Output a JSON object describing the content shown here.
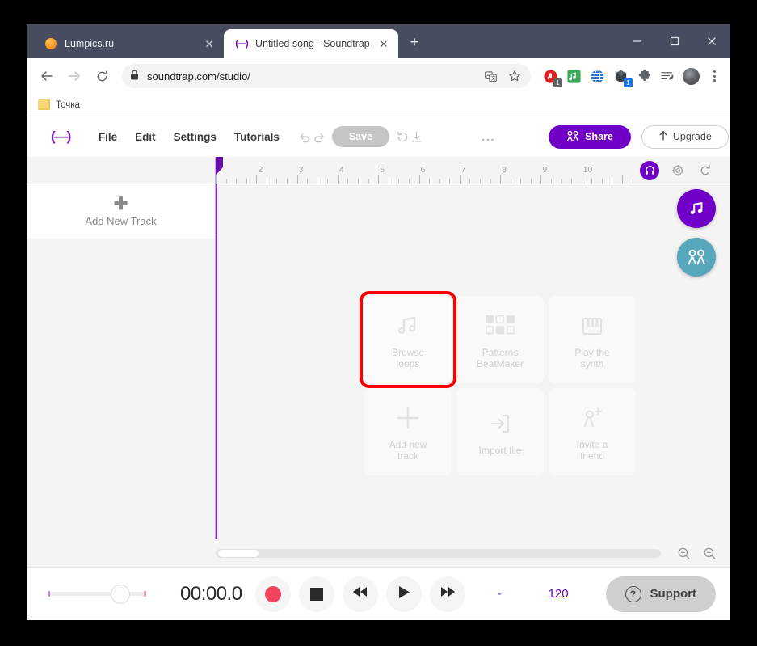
{
  "browser": {
    "tabs": [
      {
        "title": "Lumpics.ru",
        "favicon": "orange-circle-icon",
        "active": false,
        "close_label": "✕"
      },
      {
        "title": "Untitled song - Soundtrap",
        "favicon": "soundtrap-icon",
        "active": true,
        "close_label": "✕"
      }
    ],
    "new_tab_label": "+",
    "window_controls": {
      "minimize": "minimize-icon",
      "maximize": "maximize-icon",
      "close": "close-icon"
    },
    "nav": {
      "back": "back-arrow-icon",
      "forward": "forward-arrow-icon",
      "reload": "reload-icon"
    },
    "url": "soundtrap.com/studio/",
    "url_lock": "lock-icon",
    "omnibox_icons": [
      "translate-icon",
      "bookmark-star-icon"
    ],
    "extensions": [
      "adblock-icon",
      "music-extension-icon",
      "globe-extension-icon",
      "box-extension-icon",
      "puzzle-icon",
      "reading-list-icon"
    ],
    "extension_badges": {
      "adblock": "1",
      "box": "1"
    },
    "profile": "avatar",
    "menu": "kebab-menu-icon",
    "bookmarks": [
      {
        "label": "Точка",
        "icon": "folder-icon"
      }
    ]
  },
  "app": {
    "logo": "(—)",
    "menu_items": [
      "File",
      "Edit",
      "Settings",
      "Tutorials"
    ],
    "undo_icon": "undo-icon",
    "redo_icon": "redo-icon",
    "save_label": "Save",
    "history_icon": "revert-history-icon",
    "download_icon": "download-icon",
    "overflow_label": "...",
    "share_label": "Share",
    "share_icon": "people-icon",
    "upgrade_label": "Upgrade",
    "upgrade_icon": "up-arrow-icon",
    "share_color": "#7000c8"
  },
  "ruler": {
    "numbers": [
      "2",
      "3",
      "4",
      "5",
      "6",
      "7",
      "8",
      "9",
      "10"
    ],
    "playhead_position": "1",
    "metronome_icon": "headphones-icon",
    "settings_icon": "gear-icon",
    "loop_icon": "loop-icon"
  },
  "fabs": [
    {
      "name": "loop-library-fab",
      "icon": "music-note-icon",
      "color": "#7000c8"
    },
    {
      "name": "collaborate-fab",
      "icon": "people-icon",
      "color": "#56a7bb"
    }
  ],
  "track_panel": {
    "add_track_label": "Add New Track",
    "add_track_icon": "plus-icon"
  },
  "cards": [
    {
      "label": "Browse\nloops",
      "line1": "Browse",
      "line2": "loops",
      "icon": "music-note-icon",
      "highlighted": true
    },
    {
      "label": "Patterns BeatMaker",
      "line1": "Patterns",
      "line2": "BeatMaker",
      "icon": "grid-squares-icon",
      "highlighted": false
    },
    {
      "label": "Play the synth",
      "line1": "Play the",
      "line2": "synth",
      "icon": "piano-keys-icon",
      "highlighted": false
    },
    {
      "label": "Add new track",
      "line1": "Add new",
      "line2": "track",
      "icon": "plus-icon",
      "highlighted": false
    },
    {
      "label": "Import file",
      "line1": "Import file",
      "line2": "",
      "icon": "import-arrow-icon",
      "highlighted": false
    },
    {
      "label": "Invite a friend",
      "line1": "Invite a",
      "line2": "friend",
      "icon": "add-person-icon",
      "highlighted": false
    }
  ],
  "highlight_color": "#ff0000",
  "zoom_controls": {
    "zoom_in": "zoom-in-icon",
    "zoom_out": "zoom-out-icon"
  },
  "transport": {
    "volume_value": "72",
    "timecode": "00:00.0",
    "record_icon": "record-icon",
    "stop_icon": "stop-icon",
    "rewind_icon": "rewind-icon",
    "play_icon": "play-icon",
    "fastforward_icon": "fast-forward-icon",
    "key_value": "-",
    "bpm_value": "120",
    "loop_icon": "metronome-icon"
  },
  "support": {
    "label": "Support",
    "icon": "question-mark-icon"
  }
}
